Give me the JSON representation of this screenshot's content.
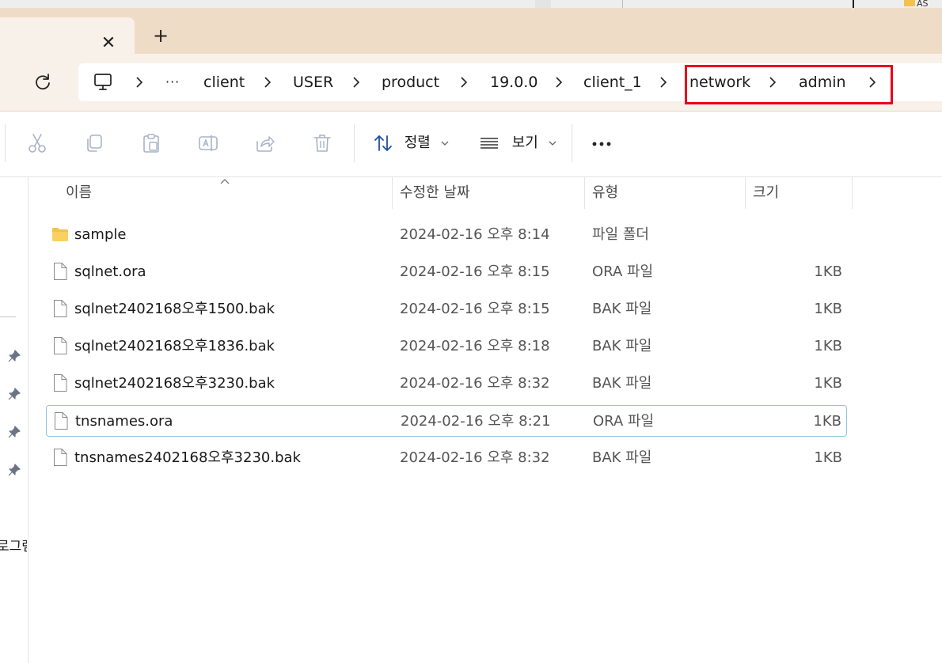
{
  "top_strip": {
    "partial_label": "AS"
  },
  "tab": {
    "close_glyph": "✕",
    "new_tab_glyph": "+"
  },
  "breadcrumb": {
    "overflow": "···",
    "items": [
      "client",
      "USER",
      "product",
      "19.0.0",
      "client_1",
      "network",
      "admin"
    ]
  },
  "toolbar": {
    "actions": [
      "cut-icon",
      "copy-icon",
      "paste-icon",
      "rename-icon",
      "share-icon",
      "delete-icon"
    ],
    "sort_label": "정렬",
    "view_label": "보기",
    "more_glyph": "•••"
  },
  "nav": {
    "partial_text": "로그램"
  },
  "columns": {
    "name": "이름",
    "date": "수정한 날짜",
    "type": "유형",
    "size": "크기"
  },
  "files": [
    {
      "name": "sample",
      "date": "2024-02-16 오후 8:14",
      "type": "파일 폴더",
      "size": "",
      "kind": "folder"
    },
    {
      "name": "sqlnet.ora",
      "date": "2024-02-16 오후 8:15",
      "type": "ORA 파일",
      "size": "1KB",
      "kind": "file"
    },
    {
      "name": "sqlnet2402168오후1500.bak",
      "date": "2024-02-16 오후 8:15",
      "type": "BAK 파일",
      "size": "1KB",
      "kind": "file"
    },
    {
      "name": "sqlnet2402168오후1836.bak",
      "date": "2024-02-16 오후 8:18",
      "type": "BAK 파일",
      "size": "1KB",
      "kind": "file"
    },
    {
      "name": "sqlnet2402168오후3230.bak",
      "date": "2024-02-16 오후 8:32",
      "type": "BAK 파일",
      "size": "1KB",
      "kind": "file"
    },
    {
      "name": "tnsnames.ora",
      "date": "2024-02-16 오후 8:21",
      "type": "ORA 파일",
      "size": "1KB",
      "kind": "file",
      "selected": true
    },
    {
      "name": "tnsnames2402168오후3230.bak",
      "date": "2024-02-16 오후 8:32",
      "type": "BAK 파일",
      "size": "1KB",
      "kind": "file"
    }
  ],
  "colors": {
    "tab_strip": "#efdcc7",
    "address_bar": "#f8f1e9",
    "highlight": "#e8001c",
    "selection_border": "#8fc6da",
    "folder": "#f2c14e"
  }
}
